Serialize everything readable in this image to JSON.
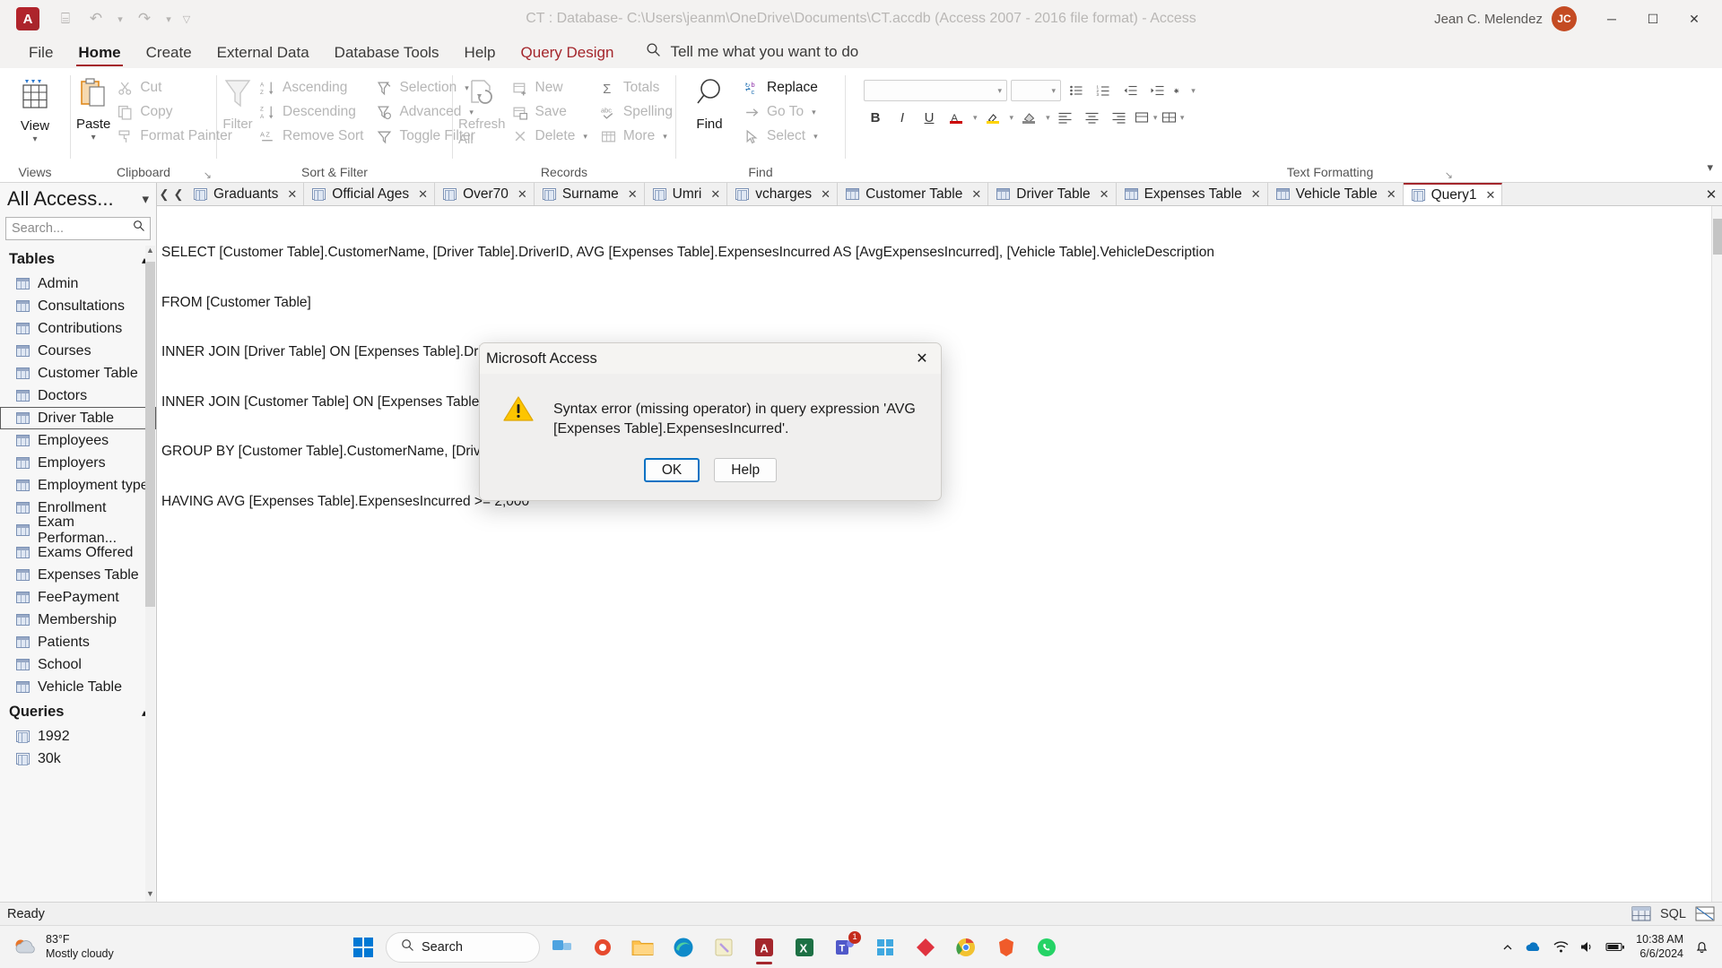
{
  "window": {
    "title": "CT : Database- C:\\Users\\jeanm\\OneDrive\\Documents\\CT.accdb (Access 2007 - 2016 file format)  -  Access",
    "user_name": "Jean C. Melendez",
    "avatar_initials": "JC",
    "app_logo_letter": "A",
    "quick_access": [
      {
        "name": "save-icon",
        "glyph": "⌸"
      },
      {
        "name": "undo-icon",
        "glyph": "↶"
      },
      {
        "name": "redo-icon",
        "glyph": "↷"
      },
      {
        "name": "customize-qat-icon",
        "glyph": "▽"
      }
    ],
    "controls": {
      "minimize": "─",
      "maximize": "☐",
      "close": "✕"
    },
    "accent_color": "#a4262c"
  },
  "ribbon": {
    "tabs": [
      {
        "label": "File",
        "state": "normal"
      },
      {
        "label": "Home",
        "state": "active"
      },
      {
        "label": "Create",
        "state": "normal"
      },
      {
        "label": "External Data",
        "state": "normal"
      },
      {
        "label": "Database Tools",
        "state": "normal"
      },
      {
        "label": "Help",
        "state": "normal"
      },
      {
        "label": "Query Design",
        "state": "contextual"
      }
    ],
    "tell_me": "Tell me what you want to do",
    "groups": {
      "views": {
        "label": "Views",
        "button": "View"
      },
      "clipboard": {
        "label": "Clipboard",
        "paste": "Paste",
        "cut": "Cut",
        "copy": "Copy",
        "format_painter": "Format Painter"
      },
      "sort_filter": {
        "label": "Sort & Filter",
        "filter": "Filter",
        "ascending": "Ascending",
        "descending": "Descending",
        "remove_sort": "Remove Sort",
        "selection": "Selection",
        "advanced": "Advanced",
        "toggle_filter": "Toggle Filter"
      },
      "records": {
        "label": "Records",
        "refresh_all": "Refresh All",
        "new": "New",
        "save": "Save",
        "delete": "Delete",
        "totals": "Totals",
        "spelling": "Spelling",
        "more": "More"
      },
      "find": {
        "label": "Find",
        "find": "Find",
        "replace": "Replace",
        "go_to": "Go To",
        "select": "Select"
      },
      "text_formatting": {
        "label": "Text Formatting",
        "font_value": "",
        "size_value": "",
        "bold": "B",
        "italic": "I",
        "underline": "U"
      }
    }
  },
  "navpane": {
    "title": "All Access...",
    "search_placeholder": "Search...",
    "groups": [
      {
        "label": "Tables",
        "expanded": true,
        "items": [
          {
            "label": "Admin",
            "icon": "table-icon",
            "selected": false
          },
          {
            "label": "Consultations",
            "icon": "table-icon",
            "selected": false
          },
          {
            "label": "Contributions",
            "icon": "table-icon",
            "selected": false
          },
          {
            "label": "Courses",
            "icon": "table-icon",
            "selected": false
          },
          {
            "label": "Customer Table",
            "icon": "table-icon",
            "selected": false
          },
          {
            "label": "Doctors",
            "icon": "table-icon",
            "selected": false
          },
          {
            "label": "Driver Table",
            "icon": "table-icon",
            "selected": true
          },
          {
            "label": "Employees",
            "icon": "table-icon",
            "selected": false
          },
          {
            "label": "Employers",
            "icon": "table-icon",
            "selected": false
          },
          {
            "label": "Employment type",
            "icon": "table-icon",
            "selected": false
          },
          {
            "label": "Enrollment",
            "icon": "table-icon",
            "selected": false
          },
          {
            "label": "Exam Performan...",
            "icon": "table-icon",
            "selected": false
          },
          {
            "label": "Exams Offered",
            "icon": "table-icon",
            "selected": false
          },
          {
            "label": "Expenses Table",
            "icon": "table-icon",
            "selected": false
          },
          {
            "label": "FeePayment",
            "icon": "table-icon",
            "selected": false
          },
          {
            "label": "Membership",
            "icon": "table-icon",
            "selected": false
          },
          {
            "label": "Patients",
            "icon": "table-icon",
            "selected": false
          },
          {
            "label": "School",
            "icon": "table-icon",
            "selected": false
          },
          {
            "label": "Vehicle Table",
            "icon": "table-icon",
            "selected": false
          }
        ]
      },
      {
        "label": "Queries",
        "expanded": true,
        "items": [
          {
            "label": "1992",
            "icon": "query-icon",
            "selected": false
          },
          {
            "label": "30k",
            "icon": "query-icon",
            "selected": false
          }
        ]
      }
    ]
  },
  "document_tabs": [
    {
      "label": "Graduants",
      "icon": "query-icon",
      "active": false
    },
    {
      "label": "Official Ages",
      "icon": "query-icon",
      "active": false
    },
    {
      "label": "Over70",
      "icon": "query-icon",
      "active": false
    },
    {
      "label": "Surname",
      "icon": "query-icon",
      "active": false
    },
    {
      "label": "Umri",
      "icon": "query-icon",
      "active": false
    },
    {
      "label": "vcharges",
      "icon": "query-icon",
      "active": false
    },
    {
      "label": "Customer Table",
      "icon": "table-icon",
      "active": false
    },
    {
      "label": "Driver Table",
      "icon": "table-icon",
      "active": false
    },
    {
      "label": "Expenses Table",
      "icon": "table-icon",
      "active": false
    },
    {
      "label": "Vehicle Table",
      "icon": "table-icon",
      "active": false
    },
    {
      "label": "Query1",
      "icon": "query-icon",
      "active": true
    }
  ],
  "sql": {
    "lines": [
      "SELECT [Customer Table].CustomerName, [Driver Table].DriverID, AVG [Expenses Table].ExpensesIncurred AS [AvgExpensesIncurred], [Vehicle Table].VehicleDescription",
      "FROM [Customer Table]",
      "INNER JOIN [Driver Table] ON [Expenses Table].DriverID = [Driver Table].DriverID",
      "INNER JOIN [Customer Table] ON [Expenses Table].CustomerID = [Customer Table].CustomerID",
      "GROUP BY [Customer Table].CustomerName, [Driver Table].DriverID",
      "HAVING AVG [Expenses Table].ExpensesIncurred >= 2,000"
    ]
  },
  "dialog": {
    "title": "Microsoft Access",
    "icon": "warning-icon",
    "message": "Syntax error (missing operator) in query expression 'AVG [Expenses Table].ExpensesIncurred'.",
    "ok_label": "OK",
    "help_label": "Help",
    "close_glyph": "✕"
  },
  "statusbar": {
    "text": "Ready",
    "view_datasheet": "datasheet-view-icon",
    "view_sql_label": "SQL",
    "view_design": "design-view-icon"
  },
  "taskbar": {
    "weather": {
      "temperature": "83°F",
      "condition": "Mostly cloudy"
    },
    "search_placeholder": "Search",
    "clock": {
      "time": "10:38 AM",
      "date": "6/6/2024"
    },
    "apps": [
      {
        "name": "taskview-icon",
        "badge": ""
      },
      {
        "name": "file-explorer-icon",
        "badge": ""
      },
      {
        "name": "edge-icon",
        "badge": ""
      },
      {
        "name": "sticky-notes-icon",
        "badge": ""
      },
      {
        "name": "access-icon",
        "badge": "",
        "active": true
      },
      {
        "name": "excel-icon",
        "badge": ""
      },
      {
        "name": "teams-icon",
        "badge": "1"
      },
      {
        "name": "store-icon",
        "badge": ""
      },
      {
        "name": "diamond-app-icon",
        "badge": ""
      },
      {
        "name": "chrome-icon",
        "badge": ""
      },
      {
        "name": "brave-icon",
        "badge": ""
      },
      {
        "name": "whatsapp-icon",
        "badge": ""
      }
    ],
    "system": [
      {
        "name": "show-hidden-icons-icon"
      },
      {
        "name": "onedrive-icon"
      },
      {
        "name": "network-icon"
      },
      {
        "name": "volume-icon"
      },
      {
        "name": "battery-icon"
      },
      {
        "name": "notification-bell-icon"
      }
    ]
  }
}
